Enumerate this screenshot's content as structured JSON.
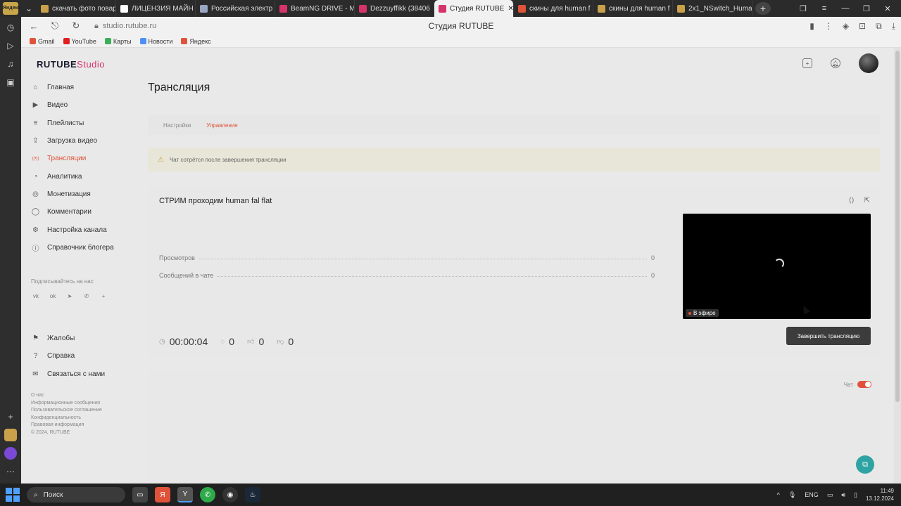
{
  "browser": {
    "tabs": [
      {
        "label": "скачать фото повар",
        "color": "#c9a14a"
      },
      {
        "label": "ЛИЦЕНЗИЯ МАЙН",
        "color": "#ffffff"
      },
      {
        "label": "Российская электр",
        "color": "#9aa7c4"
      },
      {
        "label": "BeamNG DRIVE - M",
        "color": "#d6336c"
      },
      {
        "label": "Dezzuyffikk (38406",
        "color": "#d6336c"
      },
      {
        "label": "Студия RUTUBE",
        "color": "#d6336c",
        "active": true
      },
      {
        "label": "скины для human f",
        "color": "#e0533b"
      },
      {
        "label": "скины для human f",
        "color": "#c9a14a"
      },
      {
        "label": "2x1_NSwitch_Human",
        "color": "#c9a14a"
      }
    ],
    "url": "studio.rutube.ru",
    "page_title": "Студия RUTUBE",
    "bookmarks": [
      {
        "label": "Gmail",
        "color": "#e0533b"
      },
      {
        "label": "YouTube",
        "color": "#e02020"
      },
      {
        "label": "Карты",
        "color": "#3cae5a"
      },
      {
        "label": "Новости",
        "color": "#4e8ef7"
      },
      {
        "label": "Яндекс",
        "color": "#e0533b"
      }
    ]
  },
  "brand": {
    "name": "RUTUBE",
    "suffix": "Studio"
  },
  "sidebar": {
    "items": [
      {
        "label": "Главная",
        "icon": "home-icon"
      },
      {
        "label": "Видео",
        "icon": "play-icon"
      },
      {
        "label": "Плейлисты",
        "icon": "list-icon"
      },
      {
        "label": "Загрузка видео",
        "icon": "upload-icon"
      },
      {
        "label": "Трансляции",
        "icon": "broadcast-icon",
        "active": true
      },
      {
        "label": "Аналитика",
        "icon": "chart-icon"
      },
      {
        "label": "Монетизация",
        "icon": "coin-icon"
      },
      {
        "label": "Комментарии",
        "icon": "comment-icon"
      },
      {
        "label": "Настройка канала",
        "icon": "gear-icon"
      },
      {
        "label": "Справочник блогера",
        "icon": "info-icon"
      }
    ],
    "follow_label": "Подписывайтесь на нас",
    "socials": [
      "vk-icon",
      "ok-icon",
      "telegram-icon",
      "viber-icon",
      "plus-icon"
    ],
    "secondary": [
      {
        "label": "Жалобы",
        "icon": "flag-icon"
      },
      {
        "label": "Справка",
        "icon": "help-icon"
      },
      {
        "label": "Связаться с нами",
        "icon": "mail-icon"
      }
    ],
    "footer_links": [
      "О нас",
      "Информационные сообщения",
      "Пользовательское соглашение",
      "Конфиденциальность",
      "Правовая информация",
      "© 2024, RUTUBE"
    ]
  },
  "main": {
    "title": "Трансляция",
    "tabs": [
      {
        "label": "Настройки"
      },
      {
        "label": "Управление",
        "active": true
      }
    ],
    "notice": "Чат сотрётся после завершения трансляции",
    "stream": {
      "title": "СТРИМ проходим human fal flat",
      "stats": [
        {
          "label": "Просмотров",
          "value": "0"
        },
        {
          "label": "Сообщений в чате",
          "value": "0"
        }
      ],
      "live_label": "В эфире",
      "timer": "00:00:04",
      "comments": "0",
      "likes": "0",
      "dislikes": "0",
      "end_button": "Завершить трансляцию"
    },
    "chat_label": "Чат"
  },
  "taskbar": {
    "search_label": "Поиск",
    "lang": "ENG",
    "time": "11:49",
    "date": "13.12.2024"
  }
}
